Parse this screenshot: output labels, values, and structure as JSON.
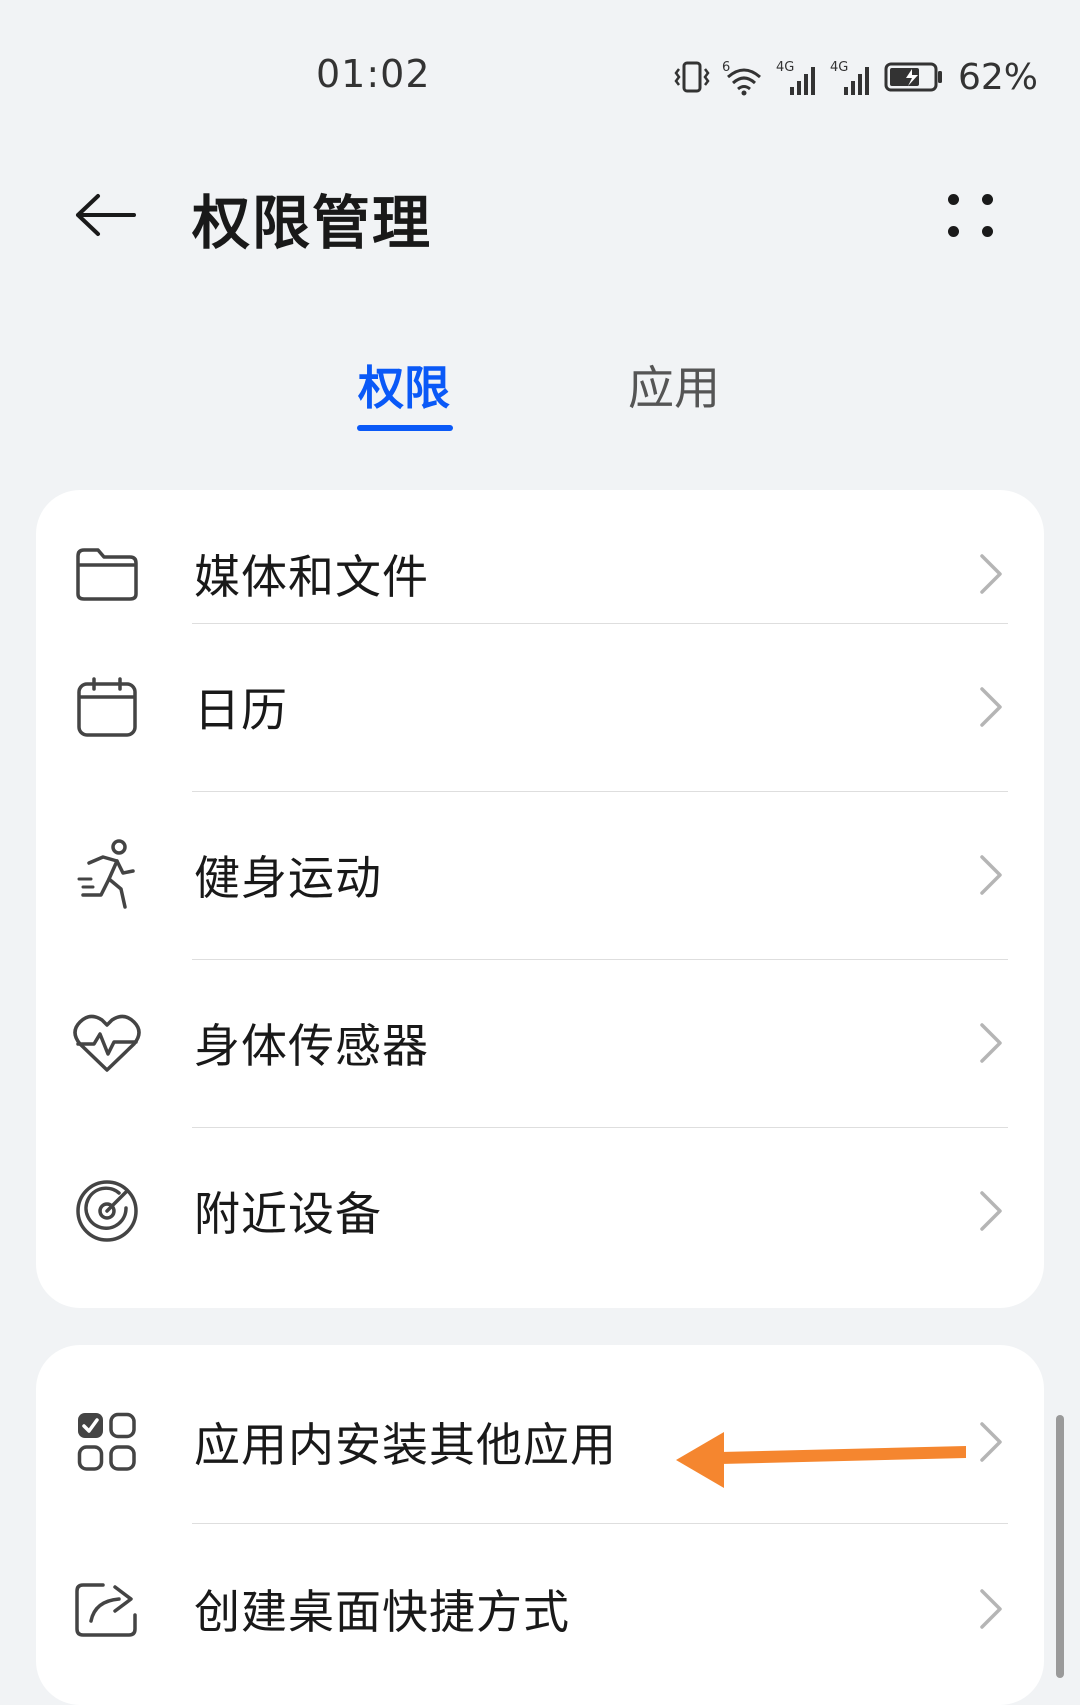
{
  "status_bar": {
    "time": "01:02",
    "battery_percent": "62%",
    "network_1": "4G",
    "network_2": "4G",
    "wifi_badge": "6"
  },
  "header": {
    "title": "权限管理",
    "back_icon": "arrow-left-icon",
    "more_icon": "four-dots-icon"
  },
  "tabs": [
    {
      "label": "权限",
      "selected": true
    },
    {
      "label": "应用",
      "selected": false
    }
  ],
  "accent_color": "#0a59f7",
  "permissions_group": [
    {
      "label": "媒体和文件",
      "icon": "folder-icon"
    },
    {
      "label": "日历",
      "icon": "calendar-icon"
    },
    {
      "label": "健身运动",
      "icon": "running-person-icon"
    },
    {
      "label": "身体传感器",
      "icon": "heart-pulse-icon"
    },
    {
      "label": "附近设备",
      "icon": "radar-icon"
    }
  ],
  "other_group": [
    {
      "label": "应用内安装其他应用",
      "icon": "app-grid-check-icon"
    },
    {
      "label": "创建桌面快捷方式",
      "icon": "share-shortcut-icon"
    }
  ],
  "annotation": {
    "color": "#f5862f",
    "icon": "orange-arrow-left-icon"
  }
}
